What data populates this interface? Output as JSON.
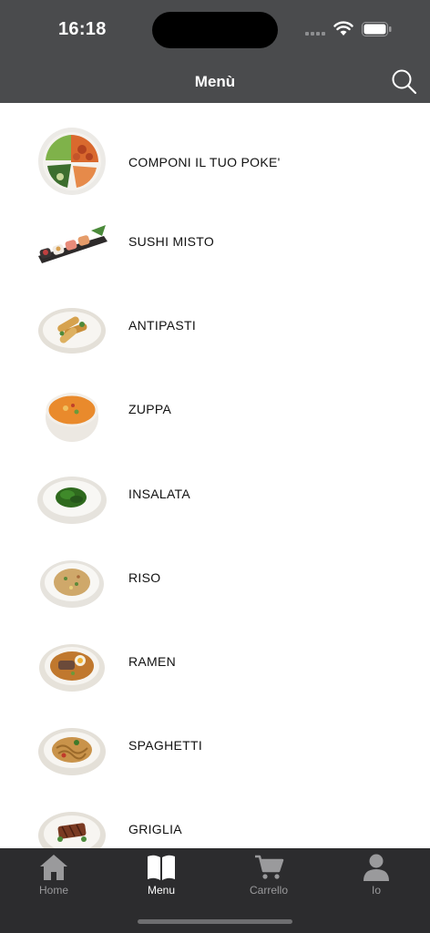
{
  "status_bar": {
    "time": "16:18"
  },
  "nav": {
    "title": "Menù",
    "search_icon": "search-icon"
  },
  "menu_items": [
    {
      "label": "COMPONI IL TUO POKE'",
      "icon": "poke-bowl-image"
    },
    {
      "label": "SUSHI MISTO",
      "icon": "sushi-platter-image"
    },
    {
      "label": "ANTIPASTI",
      "icon": "appetizer-plate-image"
    },
    {
      "label": "ZUPPA",
      "icon": "soup-bowl-image"
    },
    {
      "label": "INSALATA",
      "icon": "seaweed-salad-image"
    },
    {
      "label": "RISO",
      "icon": "fried-rice-image"
    },
    {
      "label": "RAMEN",
      "icon": "ramen-bowl-image"
    },
    {
      "label": "SPAGHETTI",
      "icon": "noodles-plate-image"
    },
    {
      "label": "GRIGLIA",
      "icon": "grill-plate-image"
    }
  ],
  "tabbar": {
    "tabs": [
      {
        "label": "Home",
        "icon": "home-icon",
        "active": false
      },
      {
        "label": "Menu",
        "icon": "book-icon",
        "active": true
      },
      {
        "label": "Carrello",
        "icon": "cart-icon",
        "active": false
      },
      {
        "label": "Io",
        "icon": "person-icon",
        "active": false
      }
    ]
  },
  "colors": {
    "header_bg": "#4a4b4d",
    "tabbar_bg": "#2c2c2e",
    "tab_inactive": "#9a9a9c",
    "tab_active": "#ffffff"
  }
}
